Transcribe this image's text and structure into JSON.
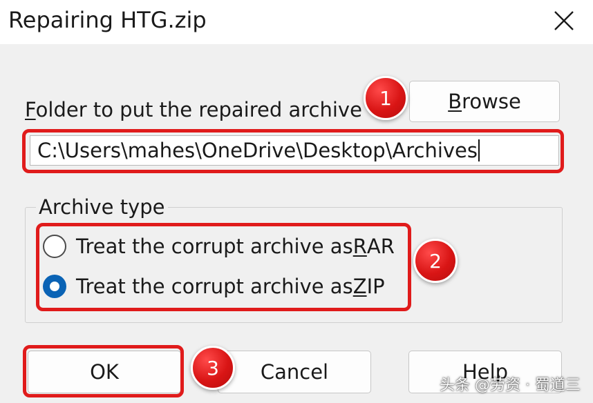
{
  "window": {
    "title": "Repairing HTG.zip",
    "close_icon": "close-icon"
  },
  "folder": {
    "label_prefix": "",
    "label_accel": "F",
    "label_rest": "older to put the repaired archive",
    "path_value": "C:\\Users\\mahes\\OneDrive\\Desktop\\Archives"
  },
  "browse": {
    "accel": "B",
    "rest": "rowse"
  },
  "archive_type": {
    "legend": "Archive type",
    "options": [
      {
        "prefix": "Treat the corrupt archive as ",
        "accel": "R",
        "rest": "AR",
        "checked": false
      },
      {
        "prefix": "Treat the corrupt archive as ",
        "accel": "Z",
        "rest": "IP",
        "checked": true
      }
    ]
  },
  "buttons": {
    "ok": "OK",
    "cancel": "Cancel",
    "help": "Help"
  },
  "badges": [
    "1",
    "2",
    "3"
  ],
  "watermark": "头条 @劳资 · 蜀道三",
  "colors": {
    "highlight": "#e01b1b",
    "radio_checked": "#0a63b5",
    "dialog_bg": "#f0f0f0"
  }
}
